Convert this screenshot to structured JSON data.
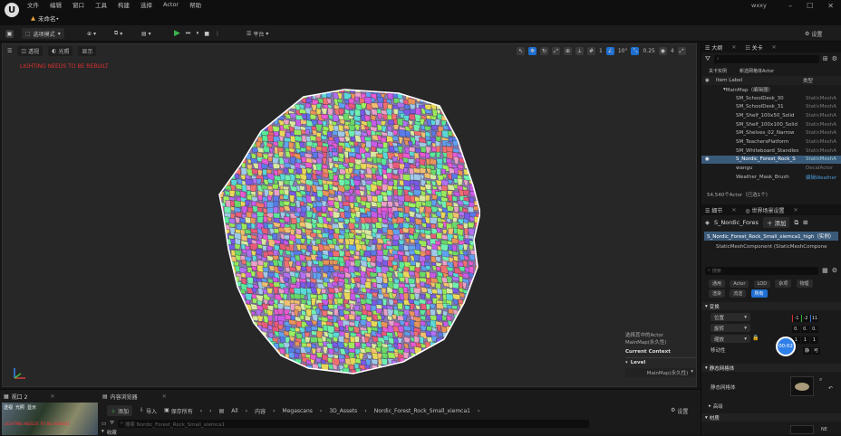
{
  "app": {
    "logo": "U",
    "user": "wxxy",
    "doc_tab": "未命名•",
    "menu": [
      "文件",
      "编辑",
      "窗口",
      "工具",
      "构建",
      "选择",
      "Actor",
      "帮助"
    ]
  },
  "toolbar": {
    "mode": "选项模式",
    "platform": "平台",
    "settings": "设置"
  },
  "viewport": {
    "view_mode": "透视",
    "lit": "光照",
    "show": "显示",
    "red_text": "LIGHTING NEEDS TO BE REBUILT",
    "grid_val": "10°",
    "scale_val": "0.25",
    "cam_val": "4",
    "chip_val": "1"
  },
  "selection_panel": {
    "line1": "选择其中的Actor",
    "line2": "MainMap(永久性)",
    "current_context": "Current Context",
    "level_label": "Level",
    "level_value": "MainMap(永久性)"
  },
  "outliner": {
    "tabs": [
      "大纲",
      "关卡"
    ],
    "filter_tabs": [
      "关卡实例",
      "新选网格体Actor"
    ],
    "col_label": "Item Label",
    "col_type": "类型",
    "rows": [
      {
        "label": "MainMap（编辑器）",
        "type": ""
      },
      {
        "label": "SM_SchoolDesk_30",
        "type": "StaticMeshA"
      },
      {
        "label": "SM_SchoolDesk_31",
        "type": "StaticMeshA"
      },
      {
        "label": "SM_Shelf_100x50_Solid",
        "type": "StaticMeshA"
      },
      {
        "label": "SM_Shelf_100x100_Solid",
        "type": "StaticMeshA"
      },
      {
        "label": "SM_Shelves_02_Narrow",
        "type": "StaticMeshA"
      },
      {
        "label": "SM_TeachersPlatform",
        "type": "StaticMeshA"
      },
      {
        "label": "SM_Whiteboard_Standles",
        "type": "StaticMeshA"
      },
      {
        "label": "S_Nordic_Forest_Rock_S",
        "type": "StaticMeshA"
      },
      {
        "label": "wangu",
        "type": "DecalActor"
      },
      {
        "label": "Weather_Mask_Brush",
        "type": "编辑Weather"
      }
    ],
    "count": "54,540个Actor（已选1个）"
  },
  "details": {
    "tabs": [
      "细节",
      "世界场景设置"
    ],
    "actor_name": "S_Nordic_Fores",
    "add": "添加",
    "component_root": "S_Nordic_Forest_Rock_Small_xiemca1_high（实例）",
    "component_child": "StaticMeshComponent (StaticMeshCompone",
    "search_placeholder": "搜索",
    "filter_row1": [
      "通用",
      "Actor",
      "LOD",
      "杂项",
      "物理"
    ],
    "filter_row2": [
      "渲染",
      "流送",
      "所有"
    ],
    "section_transform": "变换",
    "pos_label": "位置",
    "rot_label": "旋转",
    "scale_label": "缩放",
    "mobility_label": "移动性",
    "pos_vals": [
      "-1",
      "-2",
      "11"
    ],
    "rot_vals": [
      "0.",
      "0.",
      "0."
    ],
    "scale_vals": [
      "1",
      "1",
      "1"
    ],
    "mobility_vals": [
      "静",
      "可"
    ],
    "timer": "00:02",
    "section_mesh": "静态网格体",
    "mesh_label": "静态网格体",
    "section_adv": "高级",
    "section_material": "材质",
    "bottom_value": "NE"
  },
  "bottom": {
    "tab_viewport": "视口 2",
    "tab_content": "内容浏览器",
    "add": "添加",
    "import": "导入",
    "save_all": "保存所有",
    "breadcrumb": [
      "All",
      "内容",
      "Megascans",
      "3D_Assets",
      "Nordic_Forest_Rock_Small_xiemca1"
    ],
    "settings": "设置",
    "search_placeholder": "搜索 Nordic_Forest_Rock_Small_xiemca1",
    "thumb_labels": [
      "透视",
      "光照",
      "显示"
    ],
    "thumb_red": "LIGHTING NEEDS TO BE REBUILT",
    "folder": "收藏"
  },
  "colors": {
    "accent": "#1f6fd0",
    "selected_row": "#3a5a7a",
    "play": "#3bb54a"
  }
}
